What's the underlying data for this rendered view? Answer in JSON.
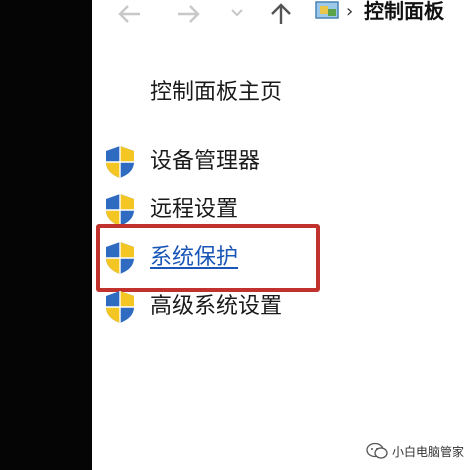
{
  "address_bar": {
    "crumb": "控制面板",
    "separator": "›",
    "back_icon": "arrow-left-icon",
    "forward_icon": "arrow-right-icon",
    "dropdown_icon": "chevron-down-icon",
    "up_icon": "arrow-up-icon",
    "location_icon": "control-panel-icon"
  },
  "sidebar": {
    "home_label": "控制面板主页",
    "items": [
      {
        "label": "设备管理器",
        "icon": "shield-icon",
        "active": false
      },
      {
        "label": "远程设置",
        "icon": "shield-icon",
        "active": false
      },
      {
        "label": "系统保护",
        "icon": "shield-icon",
        "active": true
      },
      {
        "label": "高级系统设置",
        "icon": "shield-icon",
        "active": false
      }
    ]
  },
  "colors": {
    "highlight": "#c0322b",
    "link": "#1a56b8",
    "left_bar": "#050505"
  },
  "watermark": {
    "text": "小白电脑管家",
    "icon": "wechat-icon"
  }
}
